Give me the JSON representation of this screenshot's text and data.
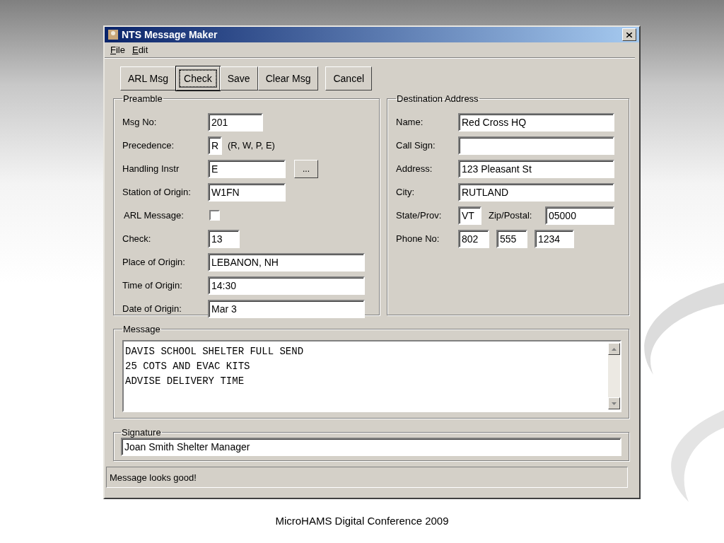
{
  "window": {
    "title": "NTS Message Maker"
  },
  "menu": [
    {
      "label": "File"
    },
    {
      "label": "Edit"
    }
  ],
  "toolbar": [
    {
      "label": "ARL Msg",
      "focused": false
    },
    {
      "label": "Check",
      "focused": true
    },
    {
      "label": "Save",
      "focused": false
    },
    {
      "label": "Clear Msg",
      "focused": false
    },
    {
      "label": "Cancel",
      "focused": false
    }
  ],
  "preamble": {
    "title": "Preamble",
    "rows": [
      {
        "kind": "text",
        "label": "Msg No:",
        "value": "201"
      },
      {
        "kind": "text",
        "label": "Precedence:",
        "value": "R",
        "note": "(R, W, P, E)"
      },
      {
        "kind": "text",
        "label": "Handling Instr",
        "value": "E",
        "button": "..."
      },
      {
        "kind": "text",
        "label": "Station of Origin:",
        "value": "W1FN"
      },
      {
        "kind": "checkbox",
        "label": "ARL Message:",
        "checked": false
      },
      {
        "kind": "text",
        "label": "Check:",
        "value": "13"
      },
      {
        "kind": "text",
        "label": "Place of Origin:",
        "value": "LEBANON, NH"
      },
      {
        "kind": "text",
        "label": "Time of Origin:",
        "value": "14:30"
      },
      {
        "kind": "text",
        "label": "Date of Origin:",
        "value": "Mar 3"
      }
    ]
  },
  "destination": {
    "title": "Destination Address",
    "rows": [
      {
        "label": "Name:",
        "values": [
          "Red Cross HQ"
        ]
      },
      {
        "label": "Call Sign:"
      },
      {
        "label": "Address:",
        "values": [
          "123 Pleasant St"
        ]
      },
      {
        "label": "City:",
        "values": [
          "RUTLAND"
        ]
      },
      {
        "label": "State/Prov:",
        "values": [
          "VT"
        ],
        "extra_label": "Zip/Postal:",
        "extra_values": [
          "05000"
        ]
      },
      {
        "label": "Phone No:",
        "values": [
          "802",
          "555",
          "1234"
        ]
      }
    ]
  },
  "message": {
    "title": "Message",
    "lines": [
      "DAVIS SCHOOL SHELTER FULL SEND",
      "25 COTS AND EVAC KITS",
      "ADVISE DELIVERY TIME"
    ]
  },
  "signature": {
    "title": "Signature",
    "value": "Joan Smith Shelter Manager"
  },
  "status_bar": "Message looks good!",
  "footer": "MicroHAMS Digital Conference 2009"
}
